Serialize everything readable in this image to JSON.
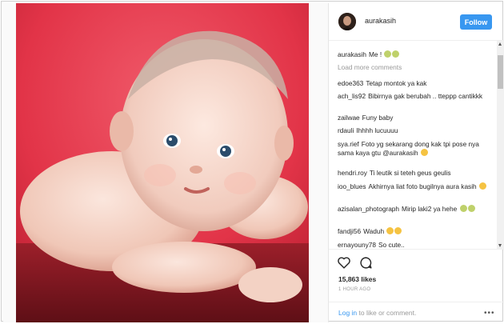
{
  "post": {
    "username": "aurakasih",
    "follow_label": "Follow",
    "caption_user": "aurakasih",
    "caption_text": "Me !",
    "load_more": "Load more comments"
  },
  "comments": [
    {
      "user": "edoe363",
      "text": "Tetap montok ya kak"
    },
    {
      "user": "ach_lis92",
      "text": "Bibirnya gak berubah .. tteppp cantikkk"
    },
    {
      "user": "zailwae",
      "text": "Funy baby"
    },
    {
      "user": "rdauli",
      "text": "Ihhhh lucuuuu"
    },
    {
      "user": "sya.rief",
      "text": "Foto yg sekarang dong kak tpi pose nya sama kaya gtu @aurakasih"
    },
    {
      "user": "hendri.roy",
      "text": "Ti leutik si teteh geus geulis"
    },
    {
      "user": "ioo_blues",
      "text": "Akhirnya liat foto bugilnya aura kasih"
    },
    {
      "user": "azisalan_photograph",
      "text": "Mirip laki2 ya hehe"
    },
    {
      "user": "fandji56",
      "text": "Waduh"
    },
    {
      "user": "ernayouny78",
      "text": "So cute.."
    }
  ],
  "stats": {
    "likes": "15,863 likes",
    "time_ago": "1 HOUR AGO"
  },
  "footer": {
    "login_link": "Log in",
    "login_rest": "to like or comment.",
    "more_label": "•••"
  },
  "colors": {
    "accent": "#3897f0",
    "photo_background": "#e8344f"
  }
}
